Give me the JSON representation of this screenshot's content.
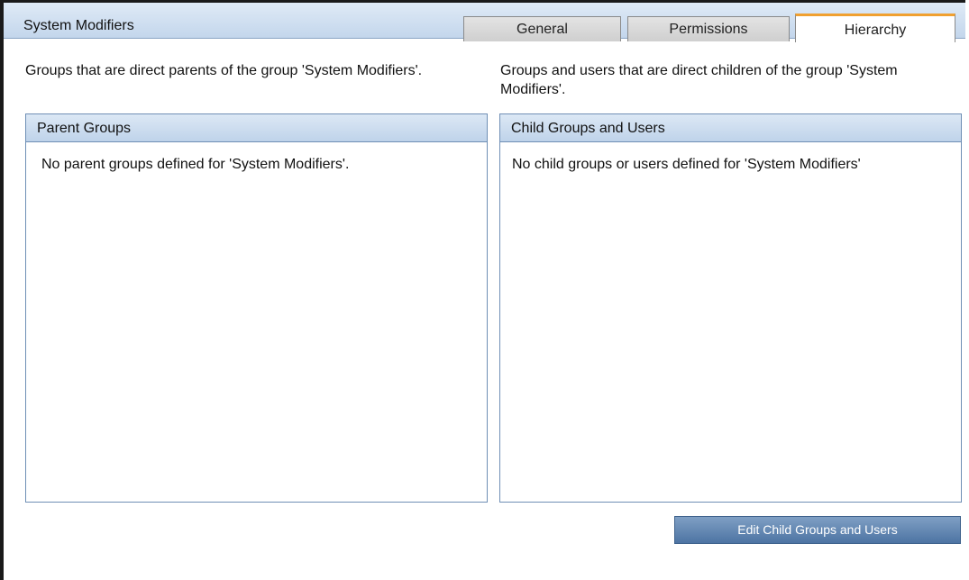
{
  "header": {
    "title": "System Modifiers"
  },
  "tabs": [
    {
      "label": "General",
      "active": false
    },
    {
      "label": "Permissions",
      "active": false
    },
    {
      "label": "Hierarchy",
      "active": true
    }
  ],
  "parents": {
    "description": "Groups that are direct parents of the group 'System Modifiers'.",
    "panel_title": "Parent Groups",
    "empty_message": "No parent groups defined for 'System Modifiers'."
  },
  "children": {
    "description": "Groups and users that are direct children of the group 'System Modifiers'.",
    "panel_title": "Child Groups and Users",
    "empty_message": "No child groups or users defined for 'System Modifiers'",
    "edit_button_label": "Edit Child Groups and Users"
  },
  "colors": {
    "header_bg": "#c3d6ec",
    "active_tab_accent": "#f0a030",
    "button_bg": "#4d74a3",
    "panel_border": "#6f8fb5"
  }
}
